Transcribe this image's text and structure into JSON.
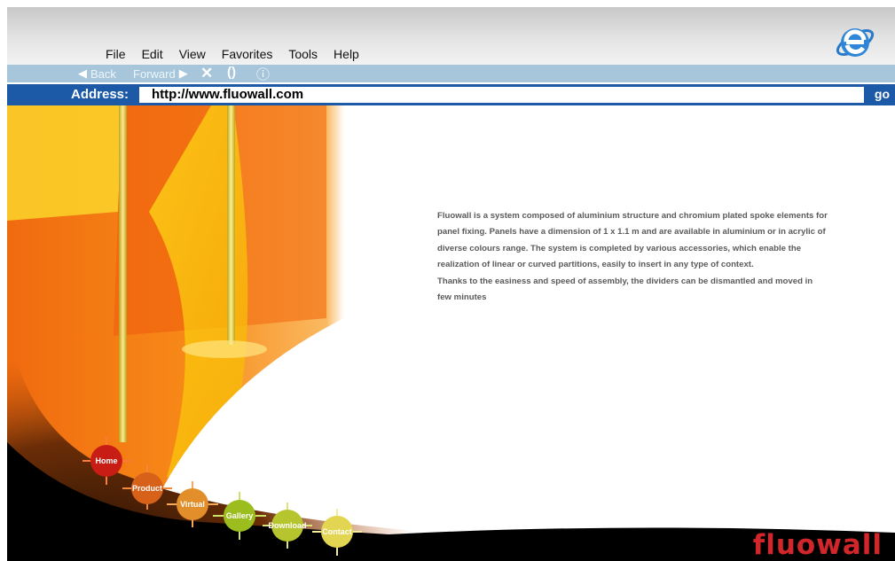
{
  "browser": {
    "menu": [
      "File",
      "Edit",
      "View",
      "Favorites",
      "Tools",
      "Help"
    ],
    "nav": {
      "back": "Back",
      "forward": "Forward"
    },
    "address_label": "Address:",
    "address_value": "http://www.fluowall.com",
    "go_label": "go",
    "logo": "ie-logo-icon"
  },
  "page": {
    "description": [
      "Fluowall is a system composed of aluminium structure and chromium plated spoke elements for panel fixing. Panels have a dimension of 1 x 1.1 m and are available in aluminium or in acrylic of diverse colours range. The system is completed by various accessories, which enable the realization of linear or curved partitions, easily to insert in any type of context.",
      "Thanks to the easiness and speed of assembly, the dividers can be dismantled and moved in few minutes"
    ],
    "nav": [
      {
        "label": "Home",
        "color": "#c81d15"
      },
      {
        "label": "Product",
        "color": "#d8611a"
      },
      {
        "label": "Virtual",
        "color": "#e28f2b"
      },
      {
        "label": "Gallery",
        "color": "#9bbd1e"
      },
      {
        "label": "Download",
        "color": "#b6c52e"
      },
      {
        "label": "Contact",
        "color": "#e2d552"
      }
    ],
    "brand": "fluowall",
    "brand_color": "#d3262b"
  }
}
